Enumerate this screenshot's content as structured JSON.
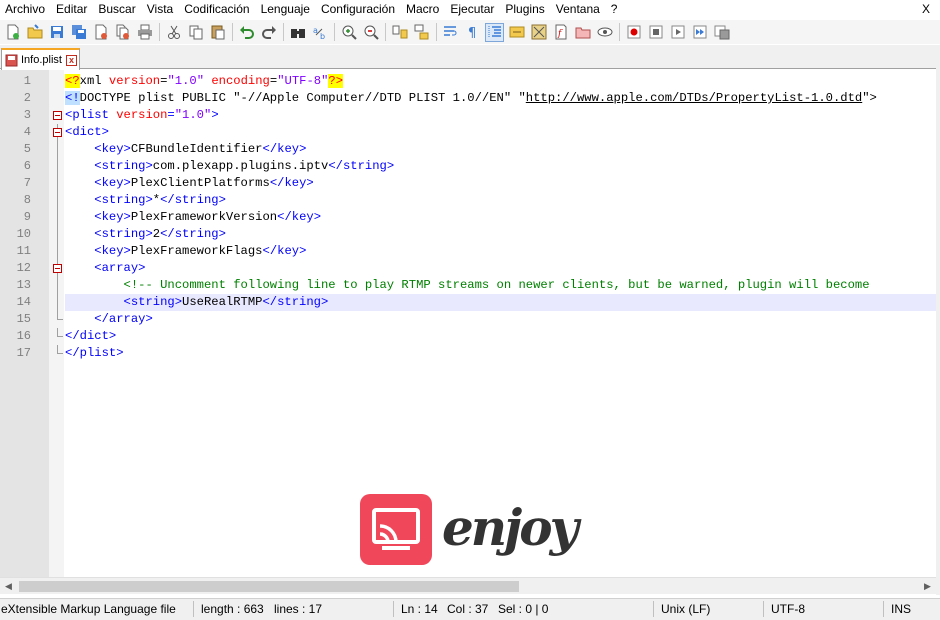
{
  "menu": {
    "items": [
      "Archivo",
      "Editar",
      "Buscar",
      "Vista",
      "Codificación",
      "Lenguaje",
      "Configuración",
      "Macro",
      "Ejecutar",
      "Plugins",
      "Ventana",
      "?"
    ],
    "close_label": "X"
  },
  "toolbar": {
    "buttons": [
      "new-file",
      "open-file",
      "save",
      "save-all",
      "close",
      "close-all",
      "print",
      "cut",
      "copy",
      "paste",
      "undo",
      "redo",
      "find",
      "replace",
      "zoom-in",
      "zoom-out",
      "sync-vertical",
      "sync-horizontal",
      "word-wrap",
      "show-all-chars",
      "indent-guide",
      "user-language",
      "document-map",
      "function-list",
      "folder-workspace",
      "monitoring",
      "record-macro",
      "stop-macro",
      "play-macro",
      "run-macro-multiple",
      "save-macro"
    ]
  },
  "tab": {
    "label": "Info.plist",
    "close_glyph": "x"
  },
  "editor": {
    "current_line": 14,
    "lines": [
      {
        "n": "1",
        "parts": [
          [
            "pi",
            "<?"
          ],
          [
            "name",
            "xml "
          ],
          [
            "attr",
            "version"
          ],
          [
            "name",
            "="
          ],
          [
            "val",
            "\"1.0\""
          ],
          [
            "name",
            " "
          ],
          [
            "attr",
            "encoding"
          ],
          [
            "name",
            "="
          ],
          [
            "val",
            "\"UTF-8\""
          ],
          [
            "pi",
            "?>"
          ]
        ]
      },
      {
        "n": "2",
        "parts": [
          [
            "dtlt",
            "<!"
          ],
          [
            "dt",
            "DOCTYPE plist PUBLIC \"-//Apple Computer//DTD PLIST 1.0//EN\" \""
          ],
          [
            "link",
            "http://www.apple.com/DTDs/PropertyList-1.0.dtd"
          ],
          [
            "dt",
            "\">"
          ]
        ]
      },
      {
        "n": "3",
        "parts": [
          [
            "tag",
            "<plist "
          ],
          [
            "attr",
            "version"
          ],
          [
            "tag",
            "="
          ],
          [
            "val",
            "\"1.0\""
          ],
          [
            "tag",
            ">"
          ]
        ]
      },
      {
        "n": "4",
        "parts": [
          [
            "tag",
            "<dict>"
          ]
        ]
      },
      {
        "n": "5",
        "parts": [
          [
            "name",
            "    "
          ],
          [
            "tag",
            "<key>"
          ],
          [
            "name",
            "CFBundleIdentifier"
          ],
          [
            "tag",
            "</key>"
          ]
        ]
      },
      {
        "n": "6",
        "parts": [
          [
            "name",
            "    "
          ],
          [
            "tag",
            "<string>"
          ],
          [
            "name",
            "com.plexapp.plugins.iptv"
          ],
          [
            "tag",
            "</string>"
          ]
        ]
      },
      {
        "n": "7",
        "parts": [
          [
            "name",
            "    "
          ],
          [
            "tag",
            "<key>"
          ],
          [
            "name",
            "PlexClientPlatforms"
          ],
          [
            "tag",
            "</key>"
          ]
        ]
      },
      {
        "n": "8",
        "parts": [
          [
            "name",
            "    "
          ],
          [
            "tag",
            "<string>"
          ],
          [
            "name",
            "*"
          ],
          [
            "tag",
            "</string>"
          ]
        ]
      },
      {
        "n": "9",
        "parts": [
          [
            "name",
            "    "
          ],
          [
            "tag",
            "<key>"
          ],
          [
            "name",
            "PlexFrameworkVersion"
          ],
          [
            "tag",
            "</key>"
          ]
        ]
      },
      {
        "n": "10",
        "parts": [
          [
            "name",
            "    "
          ],
          [
            "tag",
            "<string>"
          ],
          [
            "name",
            "2"
          ],
          [
            "tag",
            "</string>"
          ]
        ]
      },
      {
        "n": "11",
        "parts": [
          [
            "name",
            "    "
          ],
          [
            "tag",
            "<key>"
          ],
          [
            "name",
            "PlexFrameworkFlags"
          ],
          [
            "tag",
            "</key>"
          ]
        ]
      },
      {
        "n": "12",
        "parts": [
          [
            "name",
            "    "
          ],
          [
            "tag",
            "<array>"
          ]
        ]
      },
      {
        "n": "13",
        "parts": [
          [
            "name",
            "        "
          ],
          [
            "cmt",
            "<!-- Uncomment following line to play RTMP streams on newer clients, but be warned, plugin will become"
          ]
        ]
      },
      {
        "n": "14",
        "parts": [
          [
            "name",
            "        "
          ],
          [
            "tag",
            "<string>"
          ],
          [
            "name",
            "UseRealRTMP"
          ],
          [
            "tag",
            "</string>"
          ]
        ]
      },
      {
        "n": "15",
        "parts": [
          [
            "name",
            "    "
          ],
          [
            "tag",
            "</array>"
          ]
        ]
      },
      {
        "n": "16",
        "parts": [
          [
            "tag",
            "</dict>"
          ]
        ]
      },
      {
        "n": "17",
        "parts": [
          [
            "tag",
            "</plist>"
          ]
        ]
      }
    ]
  },
  "statusbar": {
    "file_type": "eXtensible Markup Language file",
    "length": "length : 663",
    "lines": "lines : 17",
    "ln": "Ln : 14",
    "col": "Col : 37",
    "sel": "Sel : 0 | 0",
    "eol": "Unix (LF)",
    "encoding": "UTF-8",
    "mode": "INS"
  },
  "watermark": {
    "text": "enjoy",
    "icon": "cast-screen-icon",
    "color": "#f0475a"
  }
}
